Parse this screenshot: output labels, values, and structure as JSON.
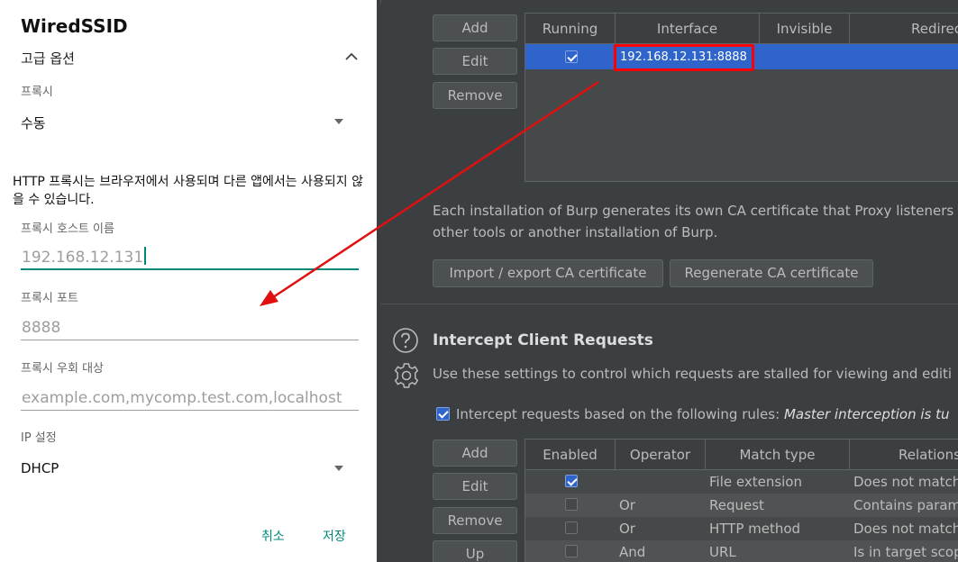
{
  "android": {
    "title": "WiredSSID",
    "advanced_options": "고급 옵션",
    "proxy_label": "프록시",
    "proxy_value": "수동",
    "note": "HTTP 프록시는 브라우저에서 사용되며 다른 앱에서는 사용되지 않을 수 있습니다.",
    "host_label": "프록시 호스트 이름",
    "host_value": "192.168.12.131",
    "port_label": "프록시 포트",
    "port_placeholder": "8888",
    "bypass_label": "프록시 우회 대상",
    "bypass_placeholder": "example.com,mycomp.test.com,localhost",
    "ip_label": "IP 설정",
    "ip_value": "DHCP",
    "cancel": "취소",
    "save": "저장"
  },
  "burp": {
    "listener_buttons": [
      "Add",
      "Edit",
      "Remove"
    ],
    "listener_columns": [
      "Running",
      "Interface",
      "Invisible",
      "Redirec"
    ],
    "listener_rows": [
      {
        "running": true,
        "interface": "192.168.12.131:8888",
        "invisible": "",
        "redirect": ""
      }
    ],
    "ca_text_1": "Each installation of Burp generates its own CA certificate that Proxy listeners",
    "ca_text_2": "other tools or another installation of Burp.",
    "import_export_button": "Import / export CA certificate",
    "regenerate_button": "Regenerate CA certificate",
    "intercept_title": "Intercept Client Requests",
    "intercept_desc": "Use these settings to control which requests are stalled for viewing and editi",
    "master_label": "Intercept requests based on the following rules:",
    "master_status": "Master interception is tu",
    "master_checked": true,
    "rule_buttons": [
      "Add",
      "Edit",
      "Remove",
      "Up"
    ],
    "rule_columns": [
      "Enabled",
      "Operator",
      "Match type",
      "Relations"
    ],
    "rules": [
      {
        "enabled": true,
        "operator": "",
        "match_type": "File extension",
        "relationship": "Does not match"
      },
      {
        "enabled": false,
        "operator": "Or",
        "match_type": "Request",
        "relationship": "Contains param"
      },
      {
        "enabled": false,
        "operator": "Or",
        "match_type": "HTTP method",
        "relationship": "Does not match"
      },
      {
        "enabled": false,
        "operator": "And",
        "match_type": "URL",
        "relationship": "Is in target scop"
      }
    ]
  },
  "colors": {
    "android_accent": "#00897b",
    "burp_bg": "#3c3f41",
    "burp_selection": "#2f65ca",
    "annotation_red": "#ff0000"
  }
}
